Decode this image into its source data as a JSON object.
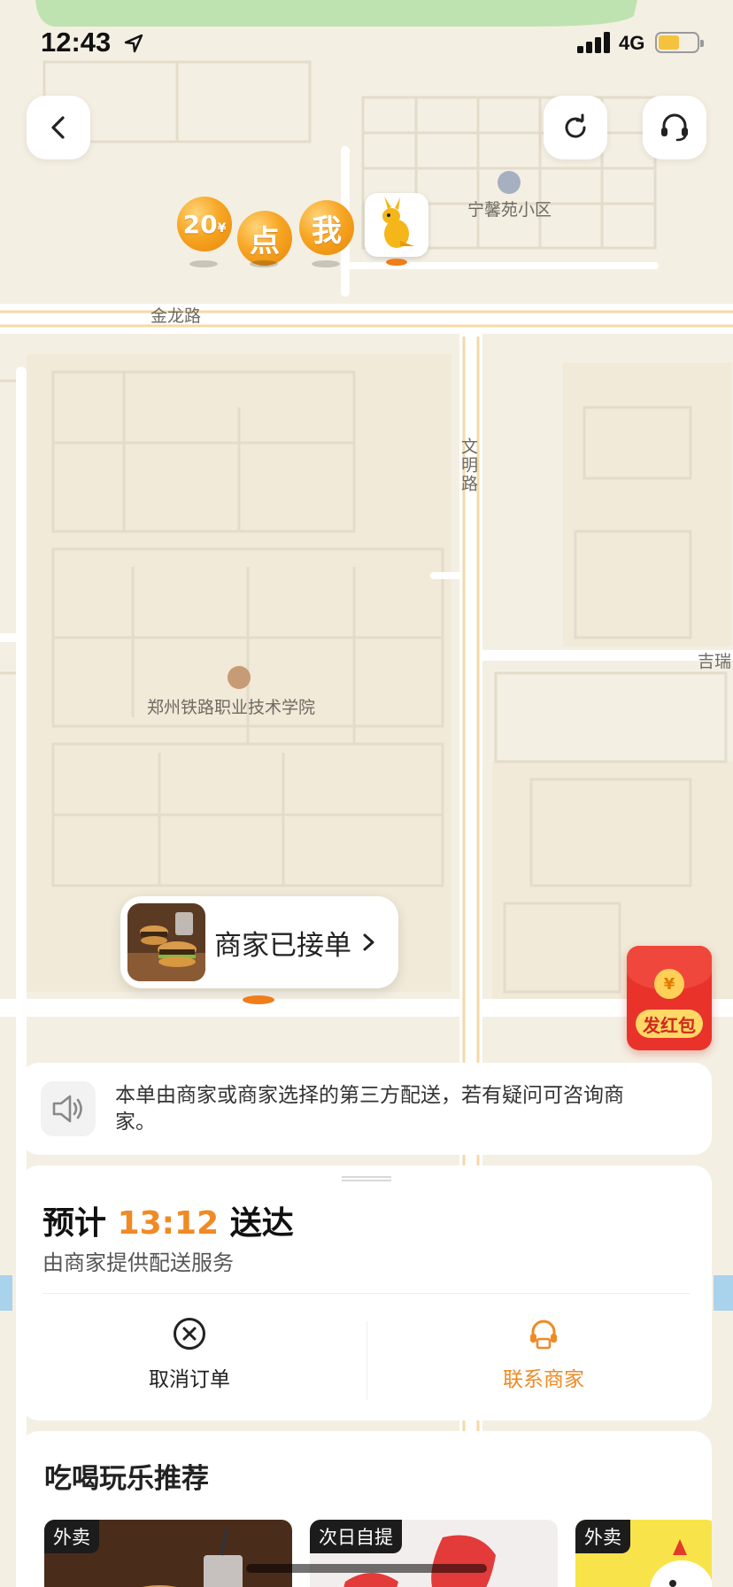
{
  "status_bar": {
    "time": "12:43",
    "network": "4G",
    "battery_level": 0.55
  },
  "top_bar": {
    "back_icon": "chevron-left-icon",
    "refresh_icon": "refresh-icon",
    "support_icon": "headset-icon"
  },
  "map": {
    "labels": {
      "jinlong_road": "金龙路",
      "wenming_road": "文明路",
      "ningxin_community": "宁馨苑小区",
      "college": "郑州铁路职业技术学院",
      "jirui": "吉瑞"
    }
  },
  "badges": {
    "coin_amount": "20",
    "coin_unit": "¥",
    "char_dian": "点",
    "char_wo": "我"
  },
  "merchant_bubble": {
    "text": "商家已接单"
  },
  "red_packet": {
    "symbol": "¥",
    "label": "发红包"
  },
  "notice": {
    "text": "本单由商家或商家选择的第三方配送，若有疑问可咨询商家。"
  },
  "delivery": {
    "eta_prefix": "预计",
    "eta_time": "13:12",
    "eta_suffix": "送达",
    "sub": "由商家提供配送服务",
    "cancel_label": "取消订单",
    "contact_label": "联系商家",
    "accent_color": "#f08a24"
  },
  "recommend": {
    "title": "吃喝玩乐推荐",
    "items": [
      {
        "tag": "外卖"
      },
      {
        "tag": "次日自提"
      },
      {
        "tag": "外卖"
      }
    ]
  }
}
